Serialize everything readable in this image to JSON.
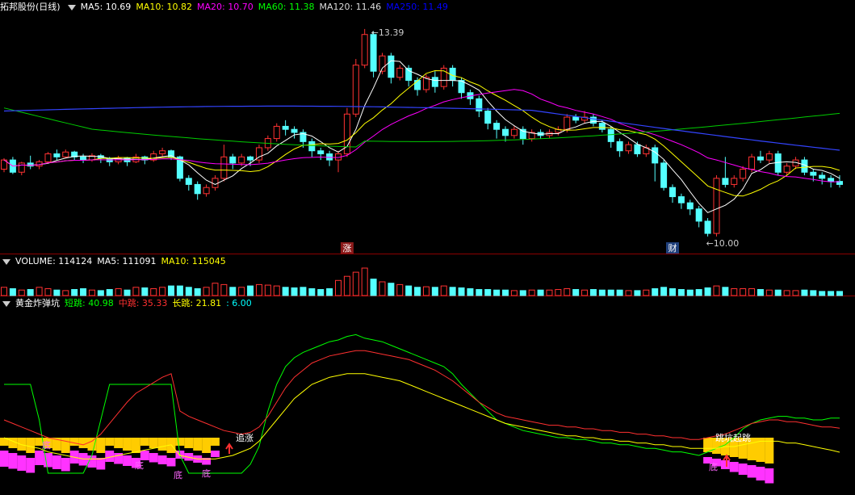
{
  "main_panel": {
    "title": "拓邦股份(日线)",
    "indicators": [
      {
        "label": "MA5: 10.69",
        "color": "#ffffff"
      },
      {
        "label": "MA10: 10.82",
        "color": "#ffff00"
      },
      {
        "label": "MA20: 10.70",
        "color": "#ff00ff"
      },
      {
        "label": "MA60: 11.38",
        "color": "#00ff00"
      },
      {
        "label": "MA120: 11.46",
        "color": "#dddddd"
      },
      {
        "label": "MA250: 11.49",
        "color": "#0000ff"
      }
    ],
    "high_label": "13.39",
    "low_label": "10.00",
    "markers": [
      {
        "text": "涨",
        "bg": "#8b1a1a"
      },
      {
        "text": "财",
        "bg": "#1f3f7a"
      }
    ]
  },
  "volume_panel": {
    "indicators": [
      {
        "label": "VOLUME: 114124",
        "color": "#ffffff"
      },
      {
        "label": "MA5: 111091",
        "color": "#ffffff"
      },
      {
        "label": "MA10: 115045",
        "color": "#ffff00"
      }
    ]
  },
  "signal_panel": {
    "title": "黄金炸弹坑",
    "indicators": [
      {
        "label": "短跳: 40.98",
        "color": "#00ff00"
      },
      {
        "label": "中跳: 35.33",
        "color": "#ff3030"
      },
      {
        "label": "长跳: 21.81",
        "color": "#ffff00"
      },
      {
        "label": ": 6.00",
        "color": "#00ffff"
      }
    ],
    "annotations": {
      "chase": "追涨",
      "pit_1": "底",
      "pit_2": "底",
      "pit_3": "底",
      "pit_4": "底",
      "pit_5": "底",
      "bounce": "跳坑起跳"
    }
  },
  "chart_data": {
    "type": "candlestick",
    "title": "拓邦股份(日线)",
    "price_range": [
      9.8,
      13.6
    ],
    "high": 13.39,
    "low": 10.0,
    "candles": [
      [
        11.1,
        11.25,
        11.05,
        11.28
      ],
      [
        11.25,
        11.05,
        11.02,
        11.3
      ],
      [
        11.05,
        11.2,
        11.0,
        11.22
      ],
      [
        11.2,
        11.15,
        11.1,
        11.32
      ],
      [
        11.15,
        11.22,
        11.1,
        11.25
      ],
      [
        11.22,
        11.35,
        11.2,
        11.38
      ],
      [
        11.35,
        11.3,
        11.25,
        11.42
      ],
      [
        11.3,
        11.38,
        11.28,
        11.42
      ],
      [
        11.38,
        11.3,
        11.25,
        11.4
      ],
      [
        11.3,
        11.25,
        11.2,
        11.35
      ],
      [
        11.25,
        11.32,
        11.22,
        11.36
      ],
      [
        11.32,
        11.28,
        11.2,
        11.35
      ],
      [
        11.28,
        11.22,
        11.15,
        11.3
      ],
      [
        11.22,
        11.28,
        11.18,
        11.32
      ],
      [
        11.28,
        11.22,
        11.15,
        11.3
      ],
      [
        11.22,
        11.3,
        11.2,
        11.35
      ],
      [
        11.3,
        11.25,
        11.18,
        11.32
      ],
      [
        11.25,
        11.35,
        11.22,
        11.4
      ],
      [
        11.35,
        11.4,
        11.3,
        11.45
      ],
      [
        11.4,
        11.3,
        11.25,
        11.42
      ],
      [
        11.3,
        10.95,
        10.9,
        11.32
      ],
      [
        10.95,
        10.85,
        10.75,
        11.0
      ],
      [
        10.85,
        10.7,
        10.6,
        10.9
      ],
      [
        10.7,
        10.8,
        10.65,
        10.85
      ],
      [
        10.8,
        10.95,
        10.75,
        11.0
      ],
      [
        10.95,
        11.3,
        10.9,
        11.5
      ],
      [
        11.3,
        11.2,
        11.1,
        11.35
      ],
      [
        11.2,
        11.3,
        11.15,
        11.35
      ],
      [
        11.3,
        11.25,
        11.15,
        11.32
      ],
      [
        11.25,
        11.45,
        11.2,
        11.5
      ],
      [
        11.45,
        11.6,
        11.4,
        11.65
      ],
      [
        11.6,
        11.8,
        11.55,
        11.85
      ],
      [
        11.8,
        11.75,
        11.65,
        11.9
      ],
      [
        11.75,
        11.7,
        11.6,
        11.8
      ],
      [
        11.7,
        11.55,
        11.45,
        11.75
      ],
      [
        11.55,
        11.4,
        11.3,
        11.6
      ],
      [
        11.4,
        11.35,
        11.25,
        11.45
      ],
      [
        11.35,
        11.25,
        11.15,
        11.4
      ],
      [
        11.25,
        11.35,
        11.05,
        11.4
      ],
      [
        11.35,
        12.0,
        11.3,
        12.1
      ],
      [
        12.0,
        12.8,
        11.95,
        12.9
      ],
      [
        12.8,
        13.3,
        12.75,
        13.39
      ],
      [
        13.3,
        12.7,
        12.6,
        13.35
      ],
      [
        12.7,
        12.95,
        12.65,
        13.0
      ],
      [
        12.95,
        12.6,
        12.5,
        13.0
      ],
      [
        12.6,
        12.75,
        12.55,
        12.8
      ],
      [
        12.75,
        12.55,
        12.45,
        12.8
      ],
      [
        12.55,
        12.4,
        12.3,
        12.6
      ],
      [
        12.4,
        12.6,
        12.35,
        12.65
      ],
      [
        12.6,
        12.45,
        12.35,
        12.7
      ],
      [
        12.45,
        12.75,
        12.4,
        12.8
      ],
      [
        12.75,
        12.55,
        12.45,
        12.8
      ],
      [
        12.55,
        12.35,
        12.25,
        12.6
      ],
      [
        12.35,
        12.25,
        12.15,
        12.4
      ],
      [
        12.25,
        12.05,
        11.95,
        12.3
      ],
      [
        12.05,
        11.85,
        11.75,
        12.1
      ],
      [
        11.85,
        11.75,
        11.6,
        11.9
      ],
      [
        11.75,
        11.65,
        11.55,
        11.8
      ],
      [
        11.65,
        11.75,
        11.6,
        11.8
      ],
      [
        11.75,
        11.6,
        11.5,
        11.8
      ],
      [
        11.6,
        11.7,
        11.55,
        11.75
      ],
      [
        11.7,
        11.65,
        11.6,
        11.75
      ],
      [
        11.65,
        11.7,
        11.6,
        11.75
      ],
      [
        11.7,
        11.75,
        11.65,
        11.8
      ],
      [
        11.75,
        11.95,
        11.7,
        12.0
      ],
      [
        11.95,
        11.9,
        11.85,
        12.0
      ],
      [
        11.9,
        11.95,
        11.85,
        12.05
      ],
      [
        11.95,
        11.85,
        11.8,
        12.0
      ],
      [
        11.85,
        11.75,
        11.7,
        11.9
      ],
      [
        11.75,
        11.55,
        11.45,
        11.8
      ],
      [
        11.55,
        11.4,
        11.3,
        11.6
      ],
      [
        11.4,
        11.5,
        11.35,
        11.55
      ],
      [
        11.5,
        11.35,
        11.3,
        11.55
      ],
      [
        11.35,
        11.45,
        11.3,
        11.5
      ],
      [
        11.45,
        11.2,
        10.9,
        11.5
      ],
      [
        11.2,
        10.8,
        10.75,
        11.25
      ],
      [
        10.8,
        10.65,
        10.55,
        10.85
      ],
      [
        10.65,
        10.55,
        10.45,
        10.7
      ],
      [
        10.55,
        10.45,
        10.35,
        10.6
      ],
      [
        10.45,
        10.25,
        10.15,
        10.5
      ],
      [
        10.25,
        10.05,
        10.0,
        10.3
      ],
      [
        10.05,
        10.95,
        10.0,
        11.0
      ],
      [
        10.95,
        10.85,
        10.8,
        11.3
      ],
      [
        10.85,
        10.95,
        10.8,
        11.0
      ],
      [
        10.95,
        11.1,
        10.9,
        11.15
      ],
      [
        11.1,
        11.3,
        11.05,
        11.35
      ],
      [
        11.3,
        11.25,
        11.2,
        11.4
      ],
      [
        11.25,
        11.35,
        11.2,
        11.4
      ],
      [
        11.35,
        11.05,
        11.0,
        11.4
      ],
      [
        11.05,
        11.15,
        11.0,
        11.2
      ],
      [
        11.15,
        11.25,
        11.1,
        11.3
      ],
      [
        11.25,
        11.05,
        11.0,
        11.3
      ],
      [
        11.05,
        11.0,
        10.9,
        11.1
      ],
      [
        11.0,
        10.95,
        10.85,
        11.05
      ],
      [
        10.95,
        10.9,
        10.8,
        11.0
      ],
      [
        10.9,
        10.85,
        10.8,
        11.0
      ]
    ],
    "volume": [
      0.3,
      0.25,
      0.2,
      0.22,
      0.3,
      0.25,
      0.2,
      0.18,
      0.22,
      0.25,
      0.2,
      0.18,
      0.22,
      0.25,
      0.2,
      0.3,
      0.28,
      0.25,
      0.3,
      0.35,
      0.35,
      0.3,
      0.25,
      0.3,
      0.45,
      0.4,
      0.3,
      0.3,
      0.35,
      0.4,
      0.38,
      0.35,
      0.3,
      0.28,
      0.3,
      0.25,
      0.22,
      0.25,
      0.55,
      0.7,
      0.85,
      1.0,
      0.6,
      0.5,
      0.45,
      0.4,
      0.35,
      0.3,
      0.32,
      0.3,
      0.35,
      0.3,
      0.28,
      0.25,
      0.22,
      0.22,
      0.2,
      0.2,
      0.18,
      0.18,
      0.2,
      0.2,
      0.2,
      0.22,
      0.25,
      0.22,
      0.2,
      0.22,
      0.2,
      0.2,
      0.2,
      0.18,
      0.18,
      0.2,
      0.25,
      0.3,
      0.25,
      0.22,
      0.2,
      0.22,
      0.28,
      0.35,
      0.3,
      0.25,
      0.25,
      0.25,
      0.22,
      0.2,
      0.2,
      0.18,
      0.18,
      0.2,
      0.18,
      0.15,
      0.15,
      0.15
    ],
    "signal_range": [
      0,
      100
    ],
    "signal_series": [
      {
        "name": "短跳",
        "color": "#00ff00",
        "values": [
          60,
          60,
          60,
          60,
          40,
          10,
          10,
          10,
          10,
          10,
          20,
          40,
          60,
          60,
          60,
          60,
          60,
          60,
          60,
          60,
          20,
          10,
          10,
          10,
          10,
          10,
          10,
          10,
          15,
          25,
          45,
          60,
          70,
          75,
          78,
          80,
          82,
          84,
          85,
          87,
          88,
          86,
          85,
          84,
          82,
          80,
          78,
          76,
          74,
          72,
          70,
          66,
          60,
          55,
          50,
          45,
          40,
          38,
          36,
          34,
          33,
          32,
          31,
          30,
          30,
          29,
          29,
          28,
          27,
          27,
          26,
          26,
          25,
          24,
          24,
          23,
          22,
          22,
          21,
          20,
          22,
          24,
          26,
          30,
          35,
          38,
          40,
          41,
          42,
          42,
          41,
          41,
          40,
          40,
          41,
          40.98
        ]
      },
      {
        "name": "中跳",
        "color": "#ff3030",
        "values": [
          40,
          38,
          36,
          34,
          32,
          30,
          29,
          28,
          27,
          26,
          28,
          32,
          38,
          44,
          50,
          55,
          58,
          61,
          64,
          66,
          45,
          42,
          40,
          38,
          36,
          34,
          33,
          32,
          33,
          36,
          42,
          50,
          58,
          64,
          68,
          72,
          74,
          76,
          77,
          78,
          79,
          79,
          78,
          77,
          76,
          75,
          74,
          72,
          70,
          68,
          65,
          62,
          58,
          54,
          50,
          47,
          44,
          42,
          41,
          40,
          39,
          38,
          37,
          37,
          36,
          36,
          35,
          35,
          34,
          34,
          33,
          33,
          32,
          32,
          31,
          31,
          30,
          30,
          29,
          29,
          30,
          31,
          32,
          34,
          36,
          38,
          39,
          40,
          40,
          39,
          39,
          38,
          37,
          36,
          36,
          35.33
        ]
      },
      {
        "name": "长跳",
        "color": "#ffff00",
        "values": [
          30,
          28,
          26,
          25,
          24,
          22,
          21,
          20,
          19,
          18,
          18,
          18,
          19,
          20,
          21,
          22,
          23,
          24,
          25,
          26,
          20,
          19,
          18,
          18,
          18,
          19,
          20,
          22,
          24,
          28,
          34,
          40,
          46,
          52,
          56,
          60,
          62,
          64,
          65,
          66,
          66,
          66,
          65,
          64,
          63,
          62,
          60,
          58,
          56,
          54,
          52,
          50,
          48,
          46,
          44,
          42,
          40,
          38,
          37,
          36,
          35,
          34,
          33,
          32,
          31,
          31,
          30,
          30,
          29,
          29,
          28,
          28,
          27,
          27,
          26,
          26,
          25,
          25,
          24,
          24,
          24,
          24,
          25,
          25,
          26,
          27,
          28,
          28,
          28,
          27,
          27,
          26,
          25,
          24,
          23,
          21.81
        ]
      }
    ]
  }
}
